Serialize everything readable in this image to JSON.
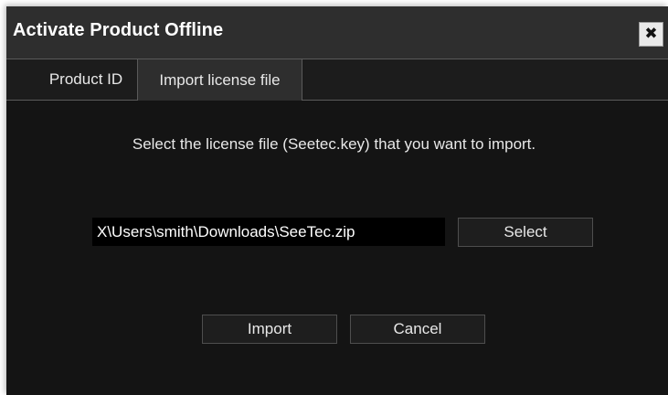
{
  "dialog": {
    "title": "Activate Product Offline",
    "close_glyph": "✖"
  },
  "tabs": [
    {
      "label": "Product ID",
      "active": false
    },
    {
      "label": "Import license file",
      "active": true
    }
  ],
  "content": {
    "instruction": "Select the license file (Seetec.key) that you want to import.",
    "file_path_value": "X\\Users\\smith\\Downloads\\SeeTec.zip",
    "select_label": "Select"
  },
  "footer": {
    "import_label": "Import",
    "cancel_label": "Cancel"
  },
  "colors": {
    "background": "#141414",
    "titlebar": "#2e2e2e",
    "text": "#e8e8e8",
    "field": "#000000"
  },
  "icons": {
    "close": "close-icon"
  }
}
